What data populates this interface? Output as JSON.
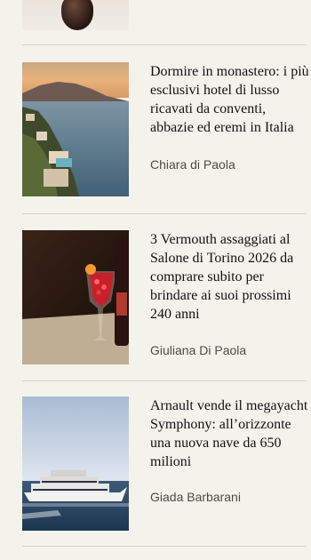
{
  "articles": [
    {
      "title": "Dormire in monastero: i più\nesclusivi hotel di lusso\nricavati da conventi,\nabbazie ed eremi in Italia",
      "author": "Chiara di Paola"
    },
    {
      "title": "3 Vermouth assaggiati al\nSalone di Torino 2026 da\ncomprare subito per\nbrindare ai suoi prossimi\n240 anni",
      "author": "Giuliana Di Paola"
    },
    {
      "title": "Arnault vende il megayacht\nSymphony: all’orizzonte\nuna nuova nave da 650\nmilioni",
      "author": "Giada Barbarani"
    }
  ]
}
